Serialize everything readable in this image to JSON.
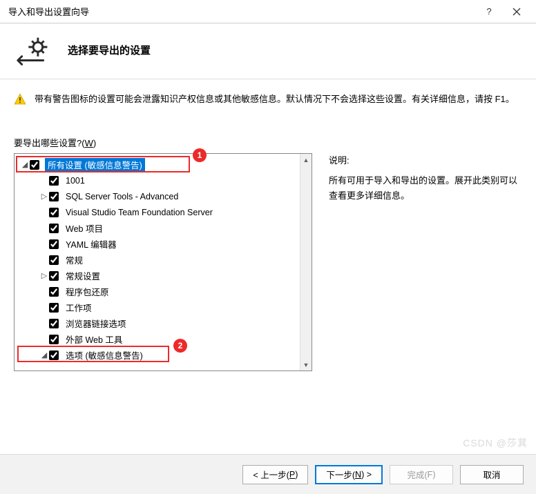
{
  "titlebar": {
    "title": "导入和导出设置向导"
  },
  "header": {
    "heading": "选择要导出的设置"
  },
  "warning": {
    "text": "带有警告图标的设置可能会泄露知识产权信息或其他敏感信息。默认情况下不会选择这些设置。有关详细信息，请按 F1。"
  },
  "section_label": {
    "main": "要导出哪些设置?(",
    "mn": "W",
    "tail": ")"
  },
  "tree": [
    {
      "indent": 0,
      "expander": "◢",
      "checked": true,
      "label": "所有设置 (敏感信息警告)",
      "selected": true
    },
    {
      "indent": 1,
      "expander": "",
      "checked": true,
      "label": "1001"
    },
    {
      "indent": 1,
      "expander": "▷",
      "checked": true,
      "label": "SQL Server Tools - Advanced"
    },
    {
      "indent": 1,
      "expander": "",
      "checked": true,
      "label": "Visual Studio Team Foundation Server"
    },
    {
      "indent": 1,
      "expander": "",
      "checked": true,
      "label": "Web 项目"
    },
    {
      "indent": 1,
      "expander": "",
      "checked": true,
      "label": "YAML 编辑器"
    },
    {
      "indent": 1,
      "expander": "",
      "checked": true,
      "label": "常规"
    },
    {
      "indent": 1,
      "expander": "▷",
      "checked": true,
      "label": "常规设置"
    },
    {
      "indent": 1,
      "expander": "",
      "checked": true,
      "label": "程序包还原"
    },
    {
      "indent": 1,
      "expander": "",
      "checked": true,
      "label": "工作项"
    },
    {
      "indent": 1,
      "expander": "",
      "checked": true,
      "label": "浏览器链接选项"
    },
    {
      "indent": 1,
      "expander": "",
      "checked": true,
      "label": "外部 Web 工具"
    },
    {
      "indent": 1,
      "expander": "◢",
      "checked": true,
      "label": "选项 (敏感信息警告)"
    }
  ],
  "description": {
    "title": "说明:",
    "body": "所有可用于导入和导出的设置。展开此类别可以查看更多详细信息。"
  },
  "buttons": {
    "prev_pre": "< 上一步(",
    "prev_mn": "P",
    "prev_post": ")",
    "next_pre": "下一步(",
    "next_mn": "N",
    "next_post": ") >",
    "finish_pre": "完成(",
    "finish_mn": "F",
    "finish_post": ")",
    "cancel": "取消"
  },
  "callouts": {
    "c1": "1",
    "c2": "2"
  },
  "watermark": "CSDN @莎萁"
}
